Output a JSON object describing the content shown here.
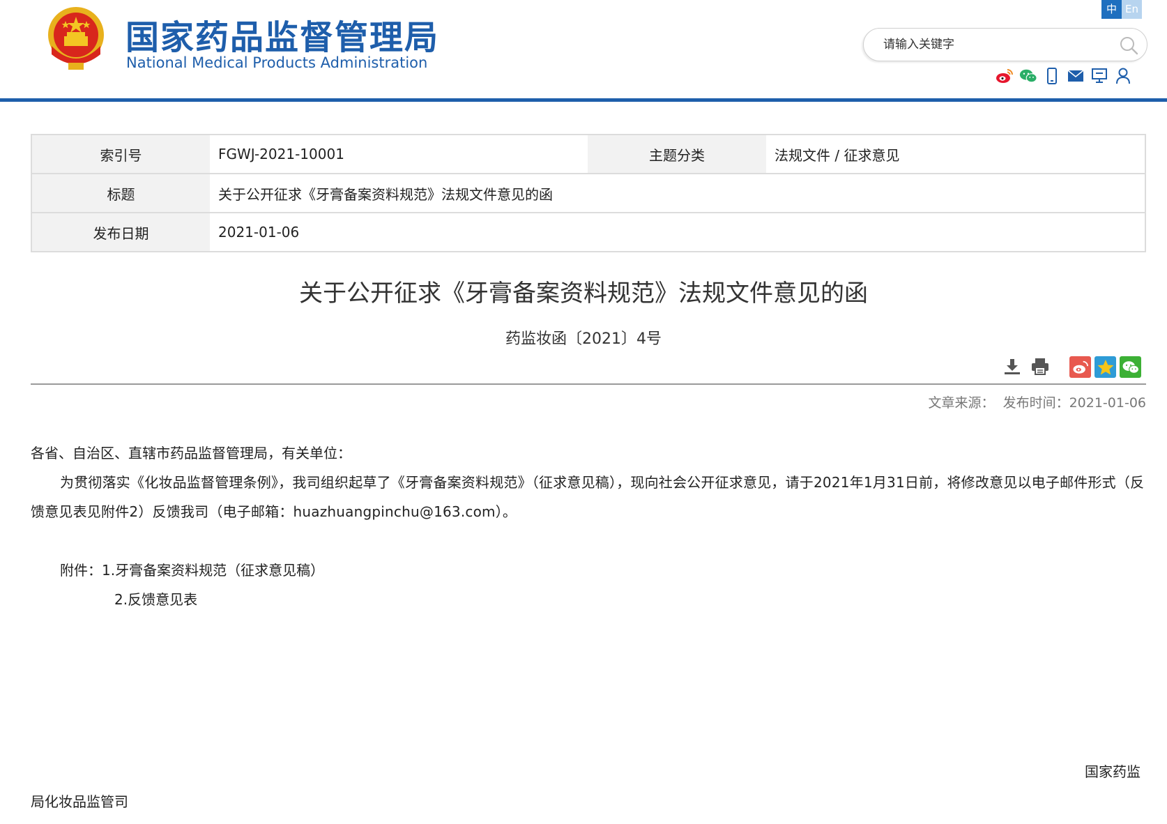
{
  "header": {
    "brand_cn": "国家药品监督管理局",
    "brand_en": "National Medical Products Administration",
    "lang_zh": "中",
    "lang_en": "En",
    "search_placeholder": "请输入关键字",
    "brand_color": "#1e5eab",
    "social_icons": [
      "weibo-icon",
      "wechat-icon",
      "mobile-icon",
      "email-icon",
      "monitor-icon",
      "user-icon"
    ]
  },
  "meta": {
    "index_label": "索引号",
    "index_value": "FGWJ-2021-10001",
    "category_label": "主题分类",
    "category_value": "法规文件 / 征求意见",
    "title_label": "标题",
    "title_value": "关于公开征求《牙膏备案资料规范》法规文件意见的函",
    "date_label": "发布日期",
    "date_value": "2021-01-06"
  },
  "article": {
    "title": "关于公开征求《牙膏备案资料规范》法规文件意见的函",
    "doc_number": "药监妆函〔2021〕4号",
    "source_label": "文章来源：",
    "publish_label": "发布时间：2021-01-06",
    "salutation": "各省、自治区、直辖市药品监督管理局，有关单位：",
    "paragraph": "为贯彻落实《化妆品监督管理条例》，我司组织起草了《牙膏备案资料规范》（征求意见稿），现向社会公开征求意见，请于2021年1月31日前，将修改意见以电子邮件形式（反馈意见表见附件2）反馈我司（电子邮箱：huazhuangpinchu@163.com）。",
    "attachment_1": "附件：1.牙膏备案资料规范（征求意见稿）",
    "attachment_2": "2.反馈意见表",
    "signature_1": "国家药监",
    "signature_2": "局化妆品监管司"
  }
}
